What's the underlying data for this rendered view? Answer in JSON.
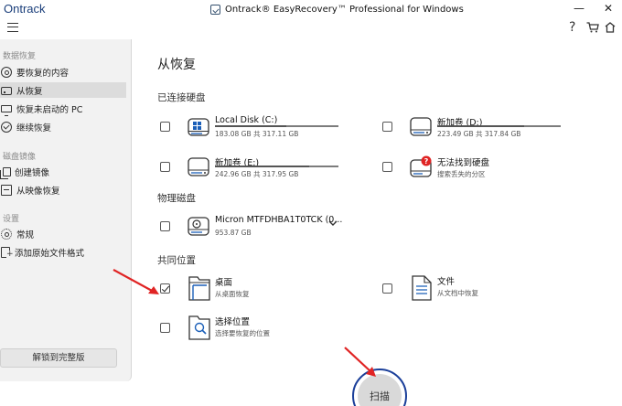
{
  "window": {
    "brand": "Ontrack",
    "title": "Ontrack® EasyRecovery™ Professional for Windows",
    "minimize_icon": "minimize-icon",
    "close_icon": "close-icon"
  },
  "toolbar": {
    "help_icon": "help-icon",
    "cart_icon": "cart-icon",
    "menu_icon": "menu-icon"
  },
  "sidebar": {
    "groups": [
      {
        "title": "数据恢复",
        "items": [
          {
            "label": "要恢复的内容",
            "icon": "search-circle-icon",
            "selected": false
          },
          {
            "label": "从恢复",
            "icon": "drive-icon",
            "selected": true
          },
          {
            "label": "恢复未启动的 PC",
            "icon": "monitor-icon",
            "selected": false
          },
          {
            "label": "继续恢复",
            "icon": "check-circle-icon",
            "selected": false
          }
        ]
      },
      {
        "title": "磁盘镜像",
        "items": [
          {
            "label": "创建镜像",
            "icon": "copy-icon",
            "selected": false
          },
          {
            "label": "从映像恢复",
            "icon": "restore-image-icon",
            "selected": false
          }
        ]
      },
      {
        "title": "设置",
        "items": [
          {
            "label": "常规",
            "icon": "gear-icon",
            "selected": false
          },
          {
            "label": "添加原始文件格式",
            "icon": "add-file-format-icon",
            "selected": false
          }
        ]
      }
    ],
    "unlock_label": "解锁到完整版"
  },
  "main": {
    "title": "从恢复",
    "connected_title": "已连接硬盘",
    "drives": [
      {
        "name": "Local Disk (C:)",
        "size": "183.08 GB 共 317.11 GB",
        "used_fraction": 0.58,
        "checked": false,
        "icon": "windows-drive-icon"
      },
      {
        "name": "新加卷 (D:)",
        "size": "223.49 GB 共 317.84 GB",
        "used_fraction": 0.7,
        "checked": false,
        "icon": "drive-icon"
      },
      {
        "name": "新加卷 (E:)",
        "size": "242.96 GB 共 317.95 GB",
        "used_fraction": 0.76,
        "checked": false,
        "icon": "drive-icon"
      },
      {
        "name": "无法找到硬盘",
        "size": "搜索丢失的分区",
        "checked": false,
        "icon": "missing-drive-icon"
      }
    ],
    "physical_title": "物理磁盘",
    "physical": [
      {
        "name": "Micron MTFDHBA1T0TCK (0...",
        "size": "953.87 GB",
        "checked": false,
        "icon": "physical-disk-icon"
      }
    ],
    "common_title": "共同位置",
    "locations": [
      {
        "name": "桌面",
        "sub": "从桌面恢复",
        "checked": true,
        "icon": "desktop-folder-icon"
      },
      {
        "name": "文件",
        "sub": "从文档中恢复",
        "checked": false,
        "icon": "documents-icon"
      },
      {
        "name": "选择位置",
        "sub": "选择要恢复的位置",
        "checked": false,
        "icon": "select-location-icon"
      }
    ],
    "scan_label": "扫描"
  },
  "colors": {
    "accent_blue": "#1b5fb8",
    "arrow_red": "#e02424",
    "sidebar_bg": "#f2f2f2",
    "scan_ring": "#1b3f9a"
  }
}
